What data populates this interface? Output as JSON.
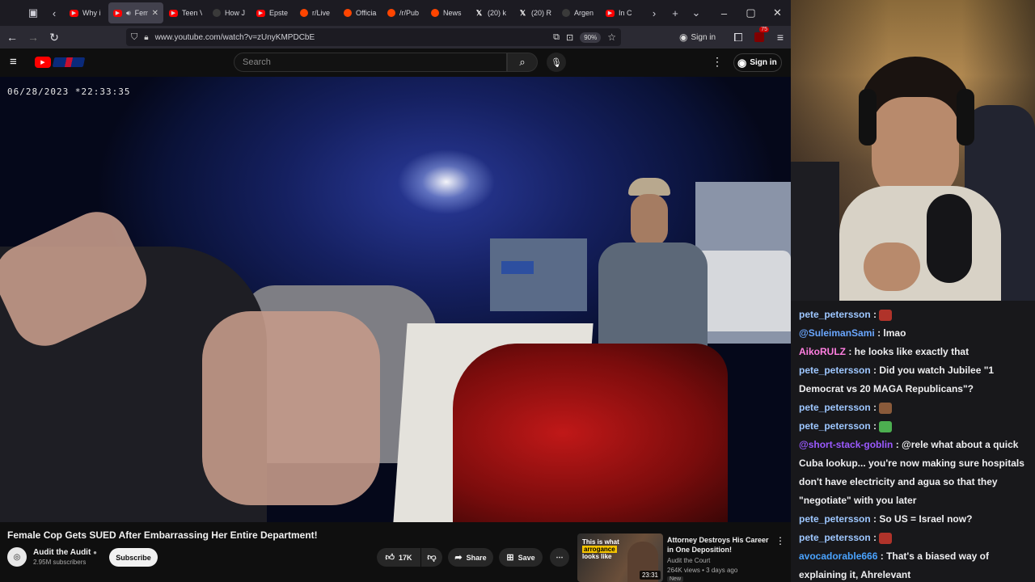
{
  "browser": {
    "tabs": [
      {
        "title": "Why i",
        "icon": "youtube-icon"
      },
      {
        "title": "Fem",
        "icon": "youtube-icon",
        "active": true
      },
      {
        "title": "Teen V",
        "icon": "youtube-icon"
      },
      {
        "title": "How J",
        "icon": "dark-icon"
      },
      {
        "title": "Epste",
        "icon": "youtube-icon"
      },
      {
        "title": "r/Live",
        "icon": "reddit-icon"
      },
      {
        "title": "Officia",
        "icon": "reddit-icon"
      },
      {
        "title": "/r/Pub",
        "icon": "reddit-icon"
      },
      {
        "title": "News",
        "icon": "reddit-icon"
      },
      {
        "title": "(20) k",
        "icon": "x-icon"
      },
      {
        "title": "(20) R",
        "icon": "x-icon"
      },
      {
        "title": "Argen",
        "icon": "dark-icon"
      },
      {
        "title": "In C",
        "icon": "youtube-icon"
      }
    ],
    "url": "www.youtube.com/watch?v=zUnyKMPDCbE",
    "zoom": "90%",
    "signin_label": "Sign in",
    "ext_badge": "75"
  },
  "youtube": {
    "search_placeholder": "Search",
    "signin_label": "Sign in",
    "video": {
      "timestamp": "06/28/2023 *22:33:35",
      "title": "Female Cop Gets SUED After Embarrassing Her Entire Department!",
      "channel": "Audit the Audit",
      "subscribers": "2.95M subscribers",
      "subscribe_label": "Subscribe",
      "likes": "17K",
      "share_label": "Share",
      "save_label": "Save"
    },
    "recommended": {
      "thumb_line1": "This is what",
      "thumb_highlight": "arrogance",
      "thumb_line3": "looks like",
      "duration": "23:31",
      "title": "Attorney Destroys His Career in One Deposition!",
      "channel": "Audit the Court",
      "meta": "264K views • 3 days ago",
      "badge": "New"
    }
  },
  "chat": [
    {
      "user": "pete_petersson",
      "color": "#9ec7ff",
      "text": "",
      "emote": "#b0332a"
    },
    {
      "user": "@SuleimanSami",
      "color": "#6aa7ff",
      "text": "lmao"
    },
    {
      "user": "AikoRULZ",
      "color": "#ff7fe0",
      "text": "he looks like exactly that"
    },
    {
      "user": "pete_petersson",
      "color": "#9ec7ff",
      "text": "Did you watch Jubilee \"1 Democrat vs 20 MAGA Republicans\"?"
    },
    {
      "user": "pete_petersson",
      "color": "#9ec7ff",
      "text": "",
      "emote": "#8a5a3a"
    },
    {
      "user": "pete_petersson",
      "color": "#9ec7ff",
      "text": "",
      "emote": "#4caf50"
    },
    {
      "user": "@short-stack-goblin",
      "color": "#9b59ff",
      "text": "@rele what about a quick Cuba lookup... you're now making sure hospitals don't have electricity and agua so that they \"negotiate\" with you later"
    },
    {
      "user": "pete_petersson",
      "color": "#9ec7ff",
      "text": "So US = Israel now?"
    },
    {
      "user": "pete_petersson",
      "color": "#9ec7ff",
      "text": "",
      "emote": "#b0332a"
    },
    {
      "user": "avocadorable666",
      "color": "#4aa3ff",
      "text": "That's a biased way of explaining it, Ahrelevant"
    }
  ]
}
